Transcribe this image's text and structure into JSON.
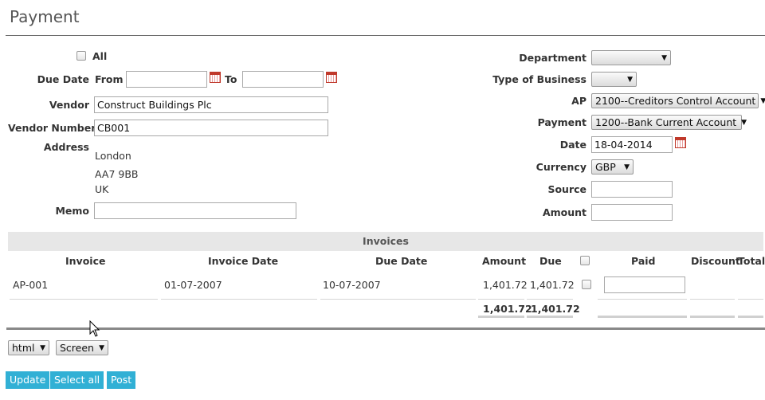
{
  "page": {
    "title": "Payment"
  },
  "filters": {
    "all_label": "All",
    "due_date_label": "Due Date",
    "from_label": "From",
    "to_label": "To",
    "from_value": "",
    "to_value": ""
  },
  "vendor": {
    "vendor_label": "Vendor",
    "vendor_value": "Construct Buildings Plc",
    "vendor_number_label": "Vendor Number",
    "vendor_number_value": "CB001",
    "address_label": "Address",
    "address_lines": [
      "London",
      "AA7 9BB",
      "UK"
    ],
    "memo_label": "Memo",
    "memo_value": ""
  },
  "right_form": {
    "department_label": "Department",
    "department_value": "",
    "type_label": "Type of Business",
    "type_value": "",
    "ap_label": "AP",
    "ap_value": "2100--Creditors Control Account",
    "payment_label": "Payment",
    "payment_value": "1200--Bank Current Account",
    "date_label": "Date",
    "date_value": "18-04-2014",
    "currency_label": "Currency",
    "currency_value": "GBP",
    "source_label": "Source",
    "source_value": "",
    "amount_label": "Amount",
    "amount_value": ""
  },
  "invoices": {
    "section_title": "Invoices",
    "headers": {
      "invoice": "Invoice",
      "invoice_date": "Invoice Date",
      "due_date": "Due Date",
      "amount": "Amount",
      "due": "Due",
      "paid": "Paid",
      "discount": "Discount",
      "total": "Total"
    },
    "rows": [
      {
        "invoice": "AP-001",
        "invoice_date": "01-07-2007",
        "due_date": "10-07-2007",
        "amount": "1,401.72",
        "due": "1,401.72",
        "paid": ""
      }
    ],
    "totals": {
      "amount": "1,401.72",
      "due": "1,401.72"
    }
  },
  "footer": {
    "format_value": "html",
    "media_value": "Screen",
    "update_label": "Update",
    "select_all_label": "Select all",
    "post_label": "Post"
  },
  "colors": {
    "button": "#31b0d5",
    "band": "#e7e7e7"
  },
  "icons": {
    "calendar": "calendar-icon",
    "dropdown": "chevron-down-icon",
    "cursor": "mouse-pointer-icon"
  }
}
